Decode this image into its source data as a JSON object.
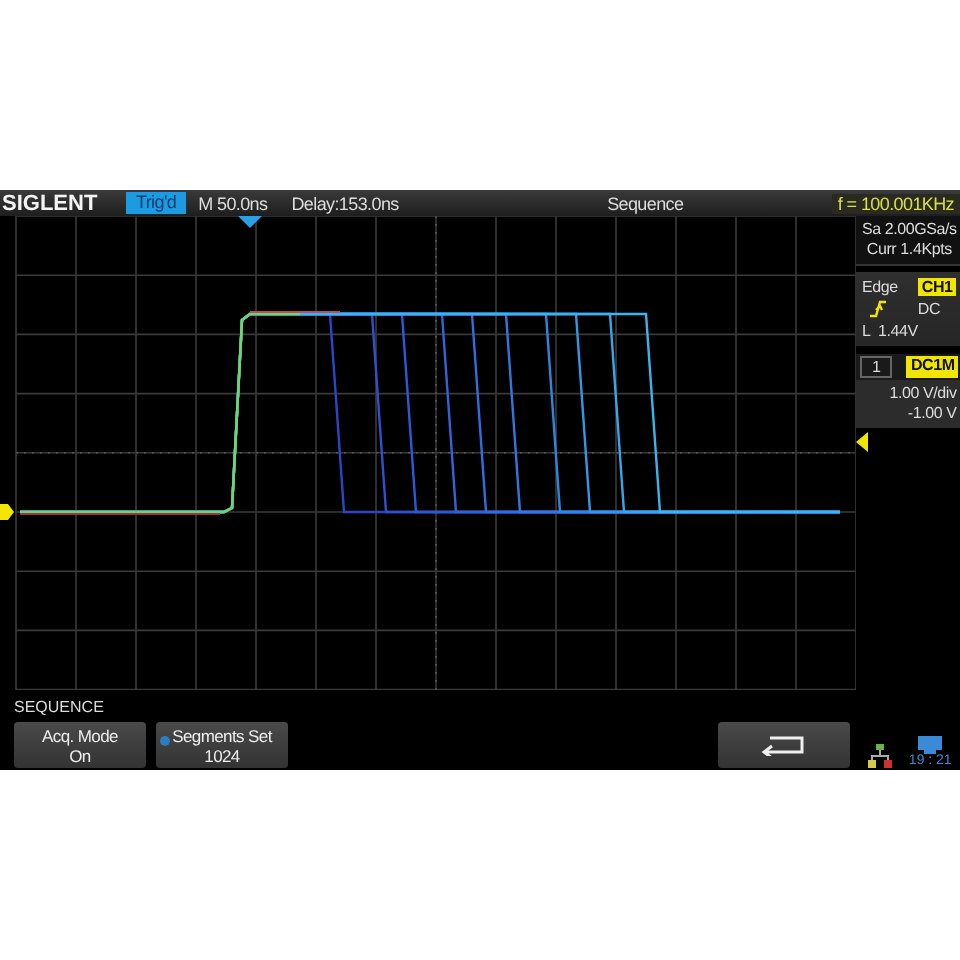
{
  "header": {
    "logo": "SIGLENT",
    "trigger_status": "Trig'd",
    "timebase": "M 50.0ns",
    "delay": "Delay:153.0ns",
    "title": "Sequence",
    "frequency": "f = 100.001KHz"
  },
  "acquisition": {
    "sample_rate": "Sa 2.00GSa/s",
    "memory": "Curr 1.4Kpts"
  },
  "trigger": {
    "type": "Edge",
    "source": "CH1",
    "level": "L  1.44V",
    "coupling": "DC"
  },
  "channel": {
    "number": "1",
    "coupling": "DC1M",
    "scale": "1.00 V/div",
    "offset": "-1.00 V"
  },
  "menu": {
    "title": "SEQUENCE",
    "buttons": [
      {
        "label": "Acq. Mode",
        "value": "On",
        "kind": "plain"
      },
      {
        "label": "Segments Set",
        "value": "1024",
        "kind": "knob"
      }
    ]
  },
  "status": {
    "time": "19 : 21"
  }
}
